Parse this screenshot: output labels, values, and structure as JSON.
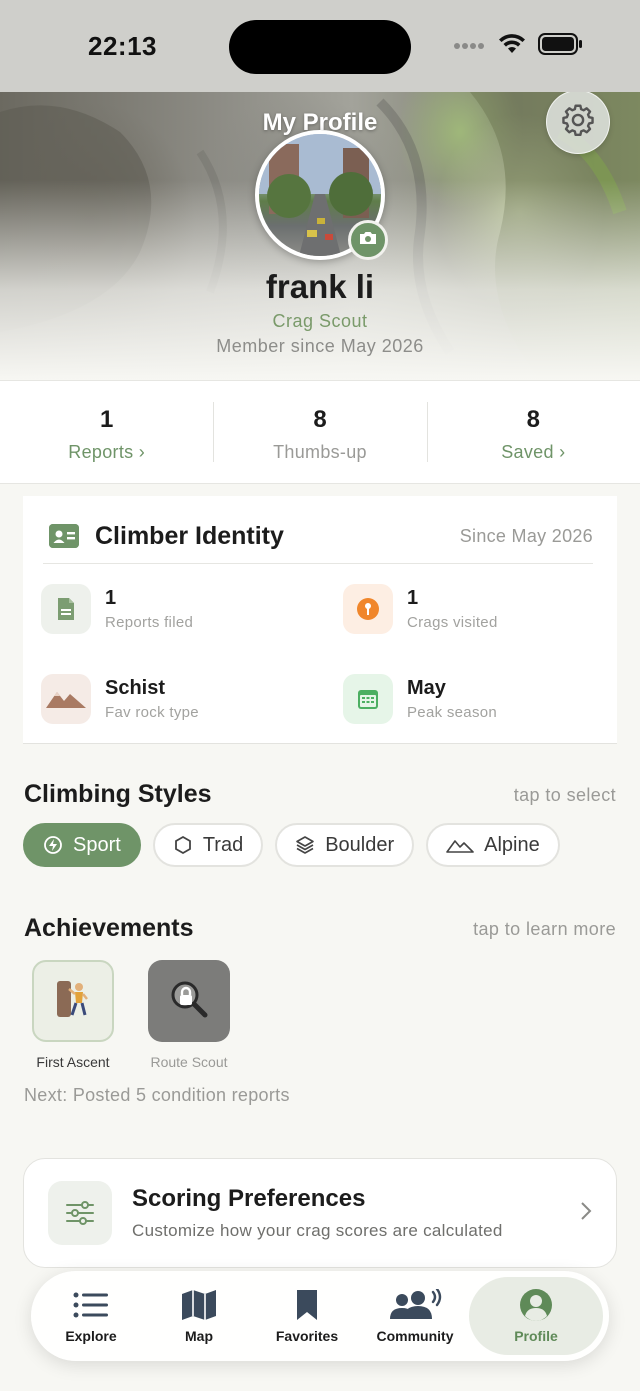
{
  "status_bar": {
    "time": "22:13"
  },
  "header": {
    "title": "My Profile",
    "name": "frank li",
    "rank": "Crag Scout",
    "member_since": "Member since May 2026",
    "settings_icon": "gear-icon",
    "camera_icon": "camera-icon"
  },
  "stats": [
    {
      "value": "1",
      "label": "Reports ›"
    },
    {
      "value": "8",
      "label": "Thumbs-up"
    },
    {
      "value": "8",
      "label": "Saved ›"
    }
  ],
  "identity": {
    "title": "Climber Identity",
    "since": "Since May 2026",
    "items": [
      {
        "value": "1",
        "label": "Reports filed",
        "icon": "document-icon"
      },
      {
        "value": "1",
        "label": "Crags visited",
        "icon": "map-pin-icon"
      },
      {
        "value": "Schist",
        "label": "Fav rock type",
        "icon": "mountains-icon"
      },
      {
        "value": "May",
        "label": "Peak season",
        "icon": "calendar-icon"
      }
    ]
  },
  "styles": {
    "title": "Climbing Styles",
    "hint": "tap to select",
    "chips": [
      {
        "label": "Sport",
        "selected": true,
        "icon": "bolt-icon"
      },
      {
        "label": "Trad",
        "selected": false,
        "icon": "hexagon-icon"
      },
      {
        "label": "Boulder",
        "selected": false,
        "icon": "layers-icon"
      },
      {
        "label": "Alpine",
        "selected": false,
        "icon": "mountain-icon"
      }
    ]
  },
  "achievements": {
    "title": "Achievements",
    "hint": "tap to learn more",
    "badges": [
      {
        "label": "First Ascent",
        "earned": true,
        "icon": "climber-icon"
      },
      {
        "label": "Route Scout",
        "earned": false,
        "icon": "locked-magnifier-icon"
      }
    ],
    "next": "Next: Posted 5 condition reports"
  },
  "scoring": {
    "title": "Scoring Preferences",
    "subtitle": "Customize how your crag scores are calculated"
  },
  "tabbar": {
    "tabs": [
      {
        "label": "Explore",
        "icon": "list-icon",
        "active": false
      },
      {
        "label": "Map",
        "icon": "map-icon",
        "active": false
      },
      {
        "label": "Favorites",
        "icon": "bookmark-icon",
        "active": false
      },
      {
        "label": "Community",
        "icon": "community-icon",
        "active": false
      },
      {
        "label": "Profile",
        "icon": "profile-icon",
        "active": true
      }
    ]
  },
  "colors": {
    "accent": "#6f9468",
    "background": "#f7f7f3"
  }
}
